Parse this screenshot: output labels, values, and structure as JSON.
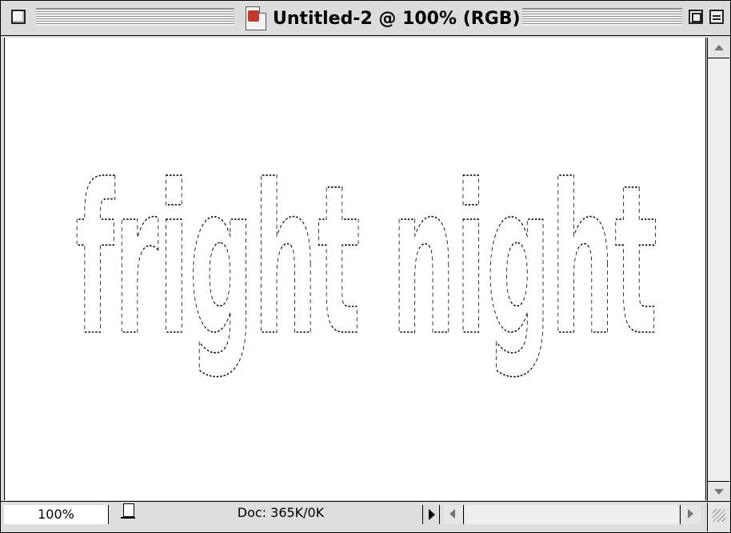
{
  "window": {
    "title": "Untitled-2 @ 100% (RGB)"
  },
  "canvas": {
    "selection_text": "fright night"
  },
  "statusbar": {
    "zoom": "100%",
    "doc_info": "Doc: 365K/0K"
  },
  "icons": {
    "close": "close-box-icon",
    "zoom": "zoom-box-icon",
    "collapse": "collapse-box-icon",
    "document": "photoshop-document-icon",
    "preview": "print-preview-icon",
    "menu": "play-arrow-icon",
    "grow": "resize-grip-icon"
  }
}
